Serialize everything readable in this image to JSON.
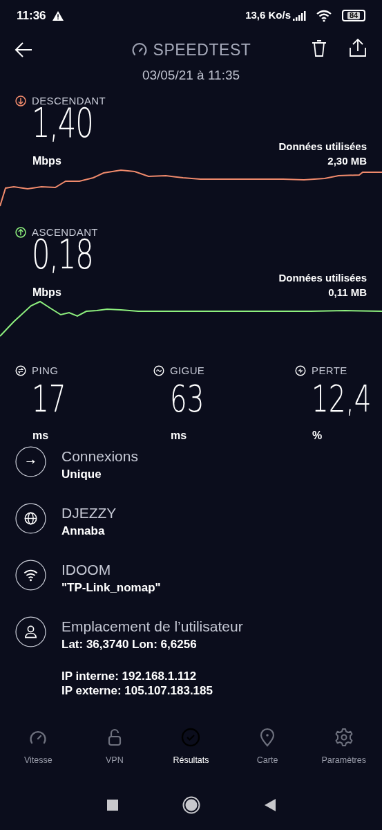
{
  "status_bar": {
    "time": "11:36",
    "speed": "13,6 Ko/s",
    "battery": "84"
  },
  "header": {
    "title": "SPEEDTEST",
    "date": "03/05/21 à 11:35"
  },
  "results": [
    {
      "kind": "download",
      "label": "DESCENDANT",
      "value": "1,40",
      "unit": "Mbps",
      "data_label": "Données utilisées",
      "data_value": "2,30 MB",
      "color": "#f08a6c"
    },
    {
      "kind": "upload",
      "label": "ASCENDANT",
      "value": "0,18",
      "unit": "Mbps",
      "data_label": "Données utilisées",
      "data_value": "0,11 MB",
      "color": "#8ef07e"
    }
  ],
  "metrics": [
    {
      "kind": "ping",
      "label": "PING",
      "value": "17",
      "unit": "ms"
    },
    {
      "kind": "jitter",
      "label": "GIGUE",
      "value": "63",
      "unit": "ms"
    },
    {
      "kind": "loss",
      "label": "PERTE",
      "value": "12,4",
      "unit": "%"
    }
  ],
  "details": [
    {
      "kind": "connections",
      "title": "Connexions",
      "value": "Unique"
    },
    {
      "kind": "operator",
      "title": "DJEZZY",
      "value": "Annaba"
    },
    {
      "kind": "wifi",
      "title": "IDOOM",
      "value": "\"TP-Link_nomap\""
    },
    {
      "kind": "location",
      "title": "Emplacement de l’utilisateur",
      "value": "Lat: 36,3740 Lon: 6,6256",
      "extra": [
        "IP interne: 192.168.1.112",
        "IP externe: 105.107.183.185"
      ]
    }
  ],
  "nav": [
    {
      "kind": "speed",
      "label": "Vitesse",
      "selected": false
    },
    {
      "kind": "vpn",
      "label": "VPN",
      "selected": false
    },
    {
      "kind": "results",
      "label": "Résultats",
      "selected": true
    },
    {
      "kind": "map",
      "label": "Carte",
      "selected": false
    },
    {
      "kind": "settings",
      "label": "Paramètres",
      "selected": false
    }
  ]
}
